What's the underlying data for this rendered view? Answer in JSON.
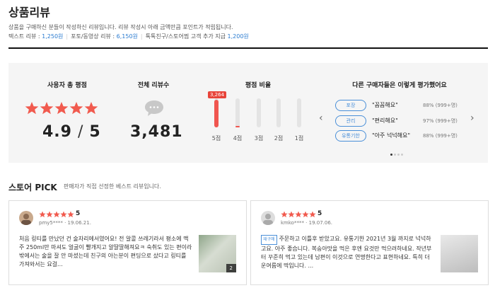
{
  "header": {
    "title": "상품리뷰",
    "description": "상품을 구매하신 분들이 작성하신 리뷰입니다. 리뷰 작성시 아래 금액만큼 포인트가 적립됩니다.",
    "points": [
      {
        "label": "텍스트 리뷰 : ",
        "amount": "1,250원"
      },
      {
        "label": "포토/동영상 리뷰 : ",
        "amount": "6,150원"
      },
      {
        "label": "톡톡친구/스토어찜 고객 추가 지급 ",
        "amount": "1,200원"
      }
    ]
  },
  "summary": {
    "rating_title": "사용자 총 평점",
    "rating_value": "4.9",
    "rating_max": "5",
    "count_title": "전체 리뷰수",
    "count_value": "3,481",
    "distribution_title": "평점 비율",
    "distribution": [
      {
        "label": "5점",
        "fraction": 0.94
      },
      {
        "label": "4점",
        "fraction": 0.04
      },
      {
        "label": "3점",
        "fraction": 0.01
      },
      {
        "label": "2점",
        "fraction": 0.0
      },
      {
        "label": "1점",
        "fraction": 0.01
      }
    ],
    "top_count": "3,264",
    "others_title": "다른 구매자들은 이렇게 평가했어요",
    "evaluations": [
      {
        "tag": "포장",
        "text": "\"꼼꼼해요\"",
        "pct": "88% (999+명)"
      },
      {
        "tag": "관리",
        "text": "\"편리해요\"",
        "pct": "97% (999+명)"
      },
      {
        "tag": "유통기한",
        "text": "\"아주 넉넉해요\"",
        "pct": "88% (999+명)"
      }
    ]
  },
  "pick": {
    "title_a": "스토어 ",
    "title_b": "PICK",
    "subtitle": "판매자가 직접 선정한 베스트 리뷰입니다.",
    "cards": [
      {
        "score": "5",
        "meta": "pmy5****  ·  19.06.21.",
        "tag": "",
        "text": "처음 링티를 만났던 건 술자리에서였어요! 전 알콜 쓰레기라서 평소에 맥주 250ml만 마셔도 얼굴이 빨개지고 알딸딸해져요ㅋ 숙취도 있는 편이라 밖에서는 술을 잘 안 마셨는데 친구의 아는분이 편딩으로 샀다고 링티를 가져와서는 요걸...",
        "photo_count": "2"
      },
      {
        "score": "5",
        "meta": "kmko****  ·  19.07.06.",
        "tag": "재구매",
        "text": "주문하고 이틀후 받았고요. 유통기한 2021년 3월 까지로 넉넉하고요. 아주 좋습니다. 복숭아맛을 먹은 후엔 요것만 먹으려하네요. 작년부터 꾸준히 먹고 있는데 남편이 이것으로 연명한다고 표현하네요. 특히 더운여름에 딱입니다. ...",
        "photo_count": ""
      }
    ]
  }
}
